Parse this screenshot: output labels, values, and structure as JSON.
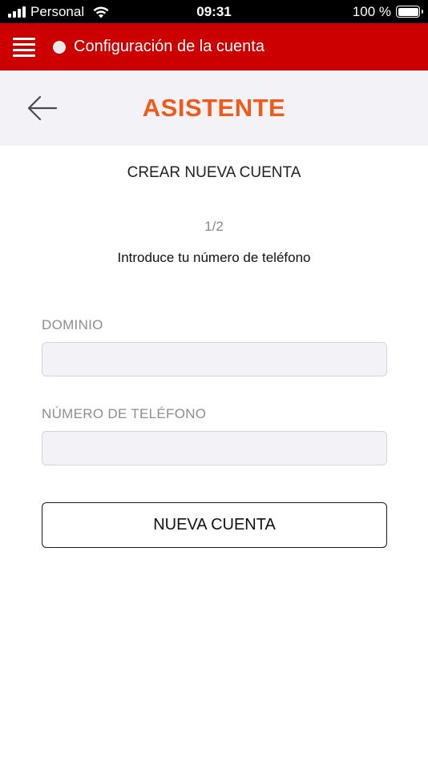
{
  "status_bar": {
    "carrier": "Personal",
    "time": "09:31",
    "battery": "100 %",
    "battery_level": 1.0
  },
  "app_bar": {
    "title": "Configuración de la cuenta",
    "menu_icon": "hamburger-menu-icon",
    "status_dot_color": "#e9e9e9",
    "brand_color": "#cc0000"
  },
  "sub_header": {
    "back_icon": "arrow-left-icon",
    "title": "ASISTENTE",
    "title_color": "#f05a1a"
  },
  "content": {
    "heading": "CREAR NUEVA CUENTA",
    "step": "1/2",
    "instruction": "Introduce tu número de teléfono"
  },
  "form": {
    "domain": {
      "label": "DOMINIO",
      "value": "",
      "placeholder": ""
    },
    "phone": {
      "label": "NÚMERO DE TELÉFONO",
      "value": "",
      "placeholder": ""
    },
    "submit_label": "NUEVA CUENTA"
  }
}
